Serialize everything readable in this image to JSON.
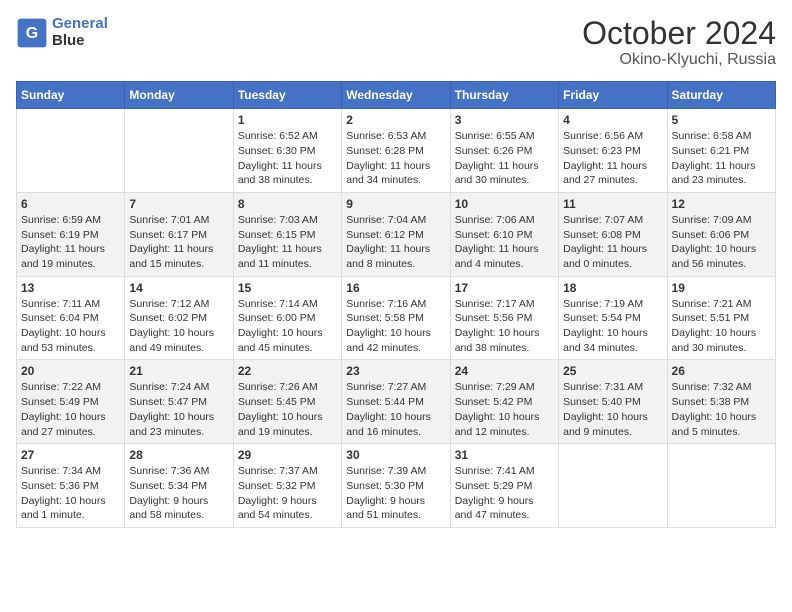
{
  "header": {
    "logo_line1": "General",
    "logo_line2": "Blue",
    "month_title": "October 2024",
    "location": "Okino-Klyuchi, Russia"
  },
  "days_of_week": [
    "Sunday",
    "Monday",
    "Tuesday",
    "Wednesday",
    "Thursday",
    "Friday",
    "Saturday"
  ],
  "weeks": [
    [
      {
        "day": "",
        "info": ""
      },
      {
        "day": "",
        "info": ""
      },
      {
        "day": "1",
        "info": "Sunrise: 6:52 AM\nSunset: 6:30 PM\nDaylight: 11 hours\nand 38 minutes."
      },
      {
        "day": "2",
        "info": "Sunrise: 6:53 AM\nSunset: 6:28 PM\nDaylight: 11 hours\nand 34 minutes."
      },
      {
        "day": "3",
        "info": "Sunrise: 6:55 AM\nSunset: 6:26 PM\nDaylight: 11 hours\nand 30 minutes."
      },
      {
        "day": "4",
        "info": "Sunrise: 6:56 AM\nSunset: 6:23 PM\nDaylight: 11 hours\nand 27 minutes."
      },
      {
        "day": "5",
        "info": "Sunrise: 6:58 AM\nSunset: 6:21 PM\nDaylight: 11 hours\nand 23 minutes."
      }
    ],
    [
      {
        "day": "6",
        "info": "Sunrise: 6:59 AM\nSunset: 6:19 PM\nDaylight: 11 hours\nand 19 minutes."
      },
      {
        "day": "7",
        "info": "Sunrise: 7:01 AM\nSunset: 6:17 PM\nDaylight: 11 hours\nand 15 minutes."
      },
      {
        "day": "8",
        "info": "Sunrise: 7:03 AM\nSunset: 6:15 PM\nDaylight: 11 hours\nand 11 minutes."
      },
      {
        "day": "9",
        "info": "Sunrise: 7:04 AM\nSunset: 6:12 PM\nDaylight: 11 hours\nand 8 minutes."
      },
      {
        "day": "10",
        "info": "Sunrise: 7:06 AM\nSunset: 6:10 PM\nDaylight: 11 hours\nand 4 minutes."
      },
      {
        "day": "11",
        "info": "Sunrise: 7:07 AM\nSunset: 6:08 PM\nDaylight: 11 hours\nand 0 minutes."
      },
      {
        "day": "12",
        "info": "Sunrise: 7:09 AM\nSunset: 6:06 PM\nDaylight: 10 hours\nand 56 minutes."
      }
    ],
    [
      {
        "day": "13",
        "info": "Sunrise: 7:11 AM\nSunset: 6:04 PM\nDaylight: 10 hours\nand 53 minutes."
      },
      {
        "day": "14",
        "info": "Sunrise: 7:12 AM\nSunset: 6:02 PM\nDaylight: 10 hours\nand 49 minutes."
      },
      {
        "day": "15",
        "info": "Sunrise: 7:14 AM\nSunset: 6:00 PM\nDaylight: 10 hours\nand 45 minutes."
      },
      {
        "day": "16",
        "info": "Sunrise: 7:16 AM\nSunset: 5:58 PM\nDaylight: 10 hours\nand 42 minutes."
      },
      {
        "day": "17",
        "info": "Sunrise: 7:17 AM\nSunset: 5:56 PM\nDaylight: 10 hours\nand 38 minutes."
      },
      {
        "day": "18",
        "info": "Sunrise: 7:19 AM\nSunset: 5:54 PM\nDaylight: 10 hours\nand 34 minutes."
      },
      {
        "day": "19",
        "info": "Sunrise: 7:21 AM\nSunset: 5:51 PM\nDaylight: 10 hours\nand 30 minutes."
      }
    ],
    [
      {
        "day": "20",
        "info": "Sunrise: 7:22 AM\nSunset: 5:49 PM\nDaylight: 10 hours\nand 27 minutes."
      },
      {
        "day": "21",
        "info": "Sunrise: 7:24 AM\nSunset: 5:47 PM\nDaylight: 10 hours\nand 23 minutes."
      },
      {
        "day": "22",
        "info": "Sunrise: 7:26 AM\nSunset: 5:45 PM\nDaylight: 10 hours\nand 19 minutes."
      },
      {
        "day": "23",
        "info": "Sunrise: 7:27 AM\nSunset: 5:44 PM\nDaylight: 10 hours\nand 16 minutes."
      },
      {
        "day": "24",
        "info": "Sunrise: 7:29 AM\nSunset: 5:42 PM\nDaylight: 10 hours\nand 12 minutes."
      },
      {
        "day": "25",
        "info": "Sunrise: 7:31 AM\nSunset: 5:40 PM\nDaylight: 10 hours\nand 9 minutes."
      },
      {
        "day": "26",
        "info": "Sunrise: 7:32 AM\nSunset: 5:38 PM\nDaylight: 10 hours\nand 5 minutes."
      }
    ],
    [
      {
        "day": "27",
        "info": "Sunrise: 7:34 AM\nSunset: 5:36 PM\nDaylight: 10 hours\nand 1 minute."
      },
      {
        "day": "28",
        "info": "Sunrise: 7:36 AM\nSunset: 5:34 PM\nDaylight: 9 hours\nand 58 minutes."
      },
      {
        "day": "29",
        "info": "Sunrise: 7:37 AM\nSunset: 5:32 PM\nDaylight: 9 hours\nand 54 minutes."
      },
      {
        "day": "30",
        "info": "Sunrise: 7:39 AM\nSunset: 5:30 PM\nDaylight: 9 hours\nand 51 minutes."
      },
      {
        "day": "31",
        "info": "Sunrise: 7:41 AM\nSunset: 5:29 PM\nDaylight: 9 hours\nand 47 minutes."
      },
      {
        "day": "",
        "info": ""
      },
      {
        "day": "",
        "info": ""
      }
    ]
  ]
}
